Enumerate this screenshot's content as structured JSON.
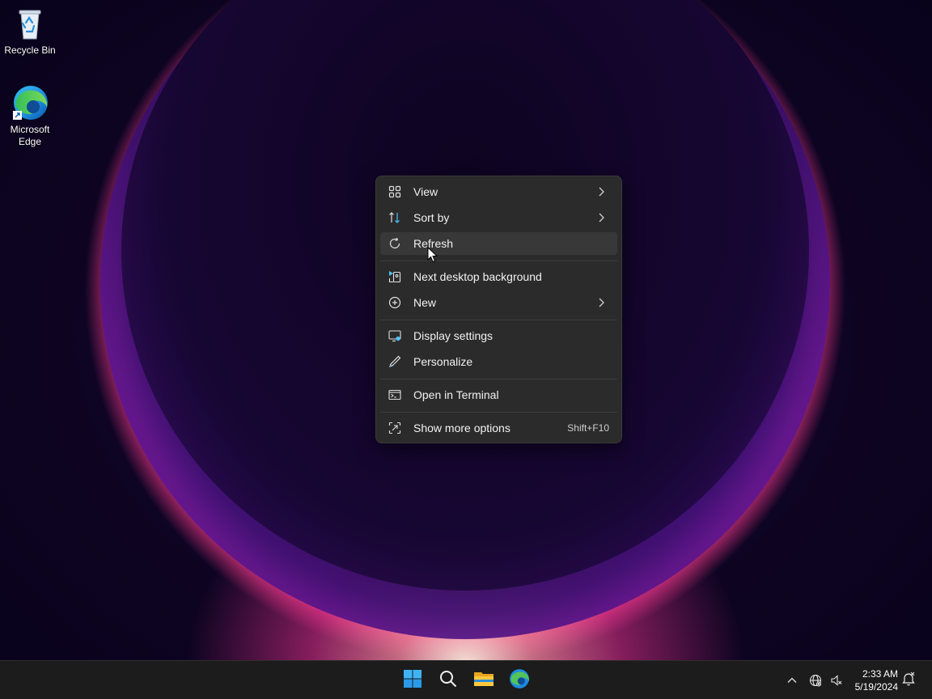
{
  "desktop": {
    "icons": [
      {
        "label": "Recycle Bin",
        "icon": "recycle-bin-icon"
      },
      {
        "label": "Microsoft Edge",
        "icon": "edge-icon"
      }
    ]
  },
  "context_menu": {
    "items": [
      {
        "label": "View",
        "icon": "grid-icon",
        "has_submenu": true
      },
      {
        "label": "Sort by",
        "icon": "sort-icon",
        "has_submenu": true
      },
      {
        "label": "Refresh",
        "icon": "refresh-icon",
        "state": "hovered"
      },
      {
        "label": "Next desktop background",
        "icon": "next-background-icon"
      },
      {
        "label": "New",
        "icon": "plus-circle-icon",
        "has_submenu": true
      },
      {
        "label": "Display settings",
        "icon": "display-settings-icon"
      },
      {
        "label": "Personalize",
        "icon": "pen-icon"
      },
      {
        "label": "Open in Terminal",
        "icon": "terminal-icon"
      },
      {
        "label": "Show more options",
        "icon": "more-options-icon",
        "shortcut": "Shift+F10"
      }
    ]
  },
  "taskbar": {
    "apps": [
      "windows-start-icon",
      "search-icon",
      "file-explorer-icon",
      "edge-icon"
    ],
    "tray": [
      "chevron-up-icon",
      "network-icon",
      "volume-muted-icon"
    ],
    "clock": {
      "time": "2:33 AM",
      "date": "5/19/2024"
    },
    "notification": "notification-bell-icon"
  },
  "colors": {
    "menu_bg": "#2b2b2b",
    "menu_hover": "#383838",
    "accent": "#4cc2ff",
    "taskbar_bg": "#1c1c1c"
  }
}
